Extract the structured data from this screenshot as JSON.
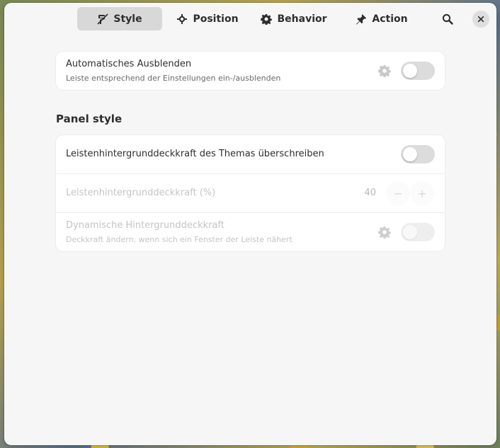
{
  "tabs": [
    {
      "label": "Style",
      "icon": "style-icon",
      "active": true
    },
    {
      "label": "Position",
      "icon": "position-icon",
      "active": false
    },
    {
      "label": "Behavior",
      "icon": "gear-icon",
      "active": false
    },
    {
      "label": "Action",
      "icon": "pin-icon",
      "active": false
    }
  ],
  "autohide": {
    "title": "Automatisches Ausblenden",
    "subtitle": "Leiste entsprechend der Einstellungen ein-/ausblenden",
    "enabled": false
  },
  "panel_style": {
    "section_title": "Panel style",
    "override": {
      "title": "Leistenhintergrunddeckkraft des Themas überschreiben",
      "enabled": false
    },
    "opacity": {
      "title": "Leistenhintergrunddeckkraft (%)",
      "value": "40",
      "minus": "−",
      "plus": "+"
    },
    "dynamic": {
      "title": "Dynamische Hintergrunddeckkraft",
      "subtitle": "Deckkraft ändern, wenn sich ein Fenster der Leiste nähert",
      "enabled": false
    }
  },
  "colors": {
    "window_bg": "#f6f6f6",
    "card_bg": "#ffffff",
    "active_tab": "#d8d8d8",
    "text": "#2e2e2e"
  }
}
